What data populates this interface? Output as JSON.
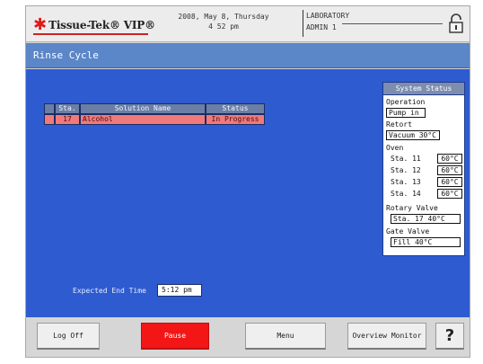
{
  "header": {
    "logo_mark": "✱",
    "logo_text": "Tissue-Tek® VIP®",
    "date": "2008, May 8, Thursday",
    "time": "4 52 pm",
    "location": "LABORATORY",
    "user": "ADMIN 1"
  },
  "title": "Rinse Cycle",
  "table": {
    "headers": [
      "",
      "Sta.",
      "Solution Name",
      "Status"
    ],
    "rows": [
      {
        "marker": "",
        "station": "17",
        "solution": "Alcohol",
        "status": "In Progress"
      }
    ]
  },
  "expected_end": {
    "label": "Expected End Time",
    "value": "5:12  pm"
  },
  "system_status": {
    "title": "System Status",
    "operation_label": "Operation",
    "operation_value": "Pump in",
    "retort_label": "Retort",
    "retort_value": "Vacuum  30°C",
    "oven_label": "Oven",
    "oven_rows": [
      {
        "station": "Sta. 11",
        "temp": "60°C"
      },
      {
        "station": "Sta. 12",
        "temp": "60°C"
      },
      {
        "station": "Sta. 13",
        "temp": "60°C"
      },
      {
        "station": "Sta. 14",
        "temp": "60°C"
      }
    ],
    "rotary_label": "Rotary Valve",
    "rotary_value": "Sta. 17  40°C",
    "gate_label": "Gate Valve",
    "gate_value": "Fill  40°C"
  },
  "buttons": {
    "logoff": "Log Off",
    "pause": "Pause",
    "menu": "Menu",
    "overview": "Overview Monitor",
    "help": "?"
  },
  "colors": {
    "main_bg": "#2f5bd0",
    "titlebar": "#5b86c7",
    "row_in_progress": "#f07a7a",
    "pause_button": "#f21616",
    "logo_mark": "#e01a1a"
  },
  "icons": {
    "lock": "lock-icon",
    "logo": "asterisk-logo-icon"
  }
}
